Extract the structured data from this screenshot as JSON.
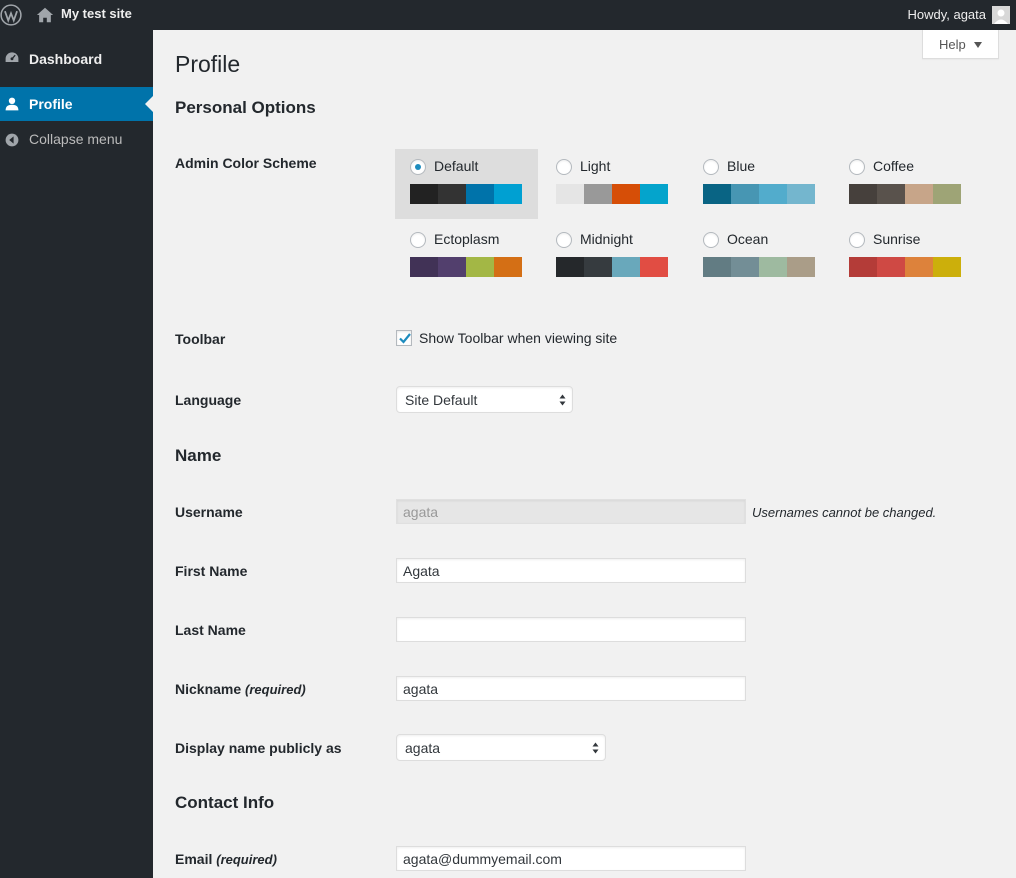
{
  "adminbar": {
    "site_name": "My test site",
    "howdy": "Howdy, agata"
  },
  "sidebar": {
    "items": [
      {
        "label": "Dashboard",
        "icon": "dashboard-icon"
      },
      {
        "label": "Profile",
        "icon": "user-icon",
        "active": true
      },
      {
        "label": "Collapse menu",
        "icon": "collapse-icon"
      }
    ]
  },
  "help": {
    "label": "Help"
  },
  "page": {
    "title": "Profile"
  },
  "sections": {
    "personal_options": "Personal Options",
    "name": "Name",
    "contact_info": "Contact Info"
  },
  "color_scheme": {
    "label": "Admin Color Scheme",
    "selected": "Default",
    "schemes": [
      {
        "name": "Default",
        "colors": [
          "#222222",
          "#333333",
          "#0073aa",
          "#00a0d2"
        ]
      },
      {
        "name": "Light",
        "colors": [
          "#e5e5e5",
          "#999999",
          "#d64e07",
          "#04a4cc"
        ]
      },
      {
        "name": "Blue",
        "colors": [
          "#096484",
          "#4796b3",
          "#52accc",
          "#74b6ce"
        ]
      },
      {
        "name": "Coffee",
        "colors": [
          "#46403c",
          "#59524c",
          "#c7a589",
          "#9ea476"
        ]
      },
      {
        "name": "Ectoplasm",
        "colors": [
          "#413256",
          "#523f6d",
          "#a3b745",
          "#d46f15"
        ]
      },
      {
        "name": "Midnight",
        "colors": [
          "#25282b",
          "#363b3f",
          "#69a8bb",
          "#e14d43"
        ]
      },
      {
        "name": "Ocean",
        "colors": [
          "#627c83",
          "#738e96",
          "#9ebaa0",
          "#aa9d88"
        ]
      },
      {
        "name": "Sunrise",
        "colors": [
          "#b43c38",
          "#cf4944",
          "#dd823b",
          "#ccaf0b"
        ]
      }
    ]
  },
  "toolbar": {
    "label": "Toolbar",
    "checkbox_label": "Show Toolbar when viewing site",
    "checked": true
  },
  "language": {
    "label": "Language",
    "value": "Site Default"
  },
  "fields": {
    "username": {
      "label": "Username",
      "value": "agata",
      "description": "Usernames cannot be changed."
    },
    "first_name": {
      "label": "First Name",
      "value": "Agata"
    },
    "last_name": {
      "label": "Last Name",
      "value": ""
    },
    "nickname": {
      "label": "Nickname",
      "required": "(required)",
      "value": "agata"
    },
    "display_name": {
      "label": "Display name publicly as",
      "value": "agata"
    },
    "email": {
      "label": "Email",
      "required": "(required)",
      "value": "agata@dummyemail.com"
    }
  }
}
